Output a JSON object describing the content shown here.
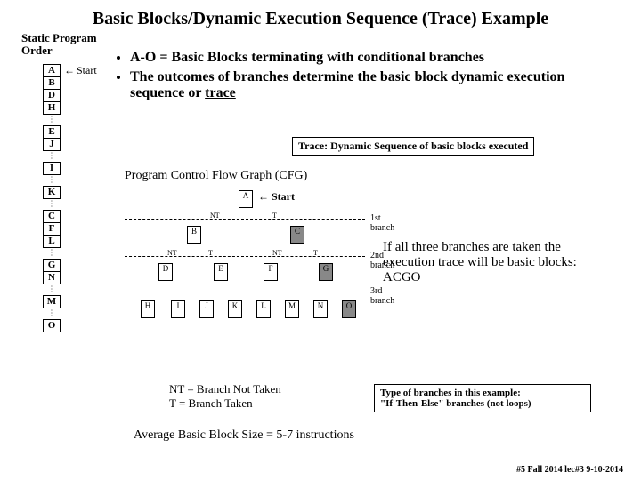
{
  "title": "Basic Blocks/Dynamic Execution Sequence (Trace) Example",
  "static_label_l1": "Static Program",
  "static_label_l2": "Order",
  "start_label": "Start",
  "blocks": [
    "A",
    "B",
    "D",
    "H",
    "",
    "E",
    "J",
    "",
    "I",
    "",
    "K",
    "",
    "C",
    "F",
    "L",
    "",
    "G",
    "N",
    "",
    "M",
    "",
    "O"
  ],
  "bullets": [
    "A-O = Basic Blocks terminating with conditional branches",
    "The outcomes of branches determine the basic block dynamic execution sequence or "
  ],
  "bullet2_underlined": "trace",
  "trace_box": "Trace:  Dynamic Sequence of basic blocks executed",
  "cfg_title": "Program Control Flow Graph (CFG)",
  "cfg_start": "Start",
  "cfg": {
    "root": "A",
    "level2": {
      "left": "B",
      "right": "C"
    },
    "level3": [
      "D",
      "E",
      "F",
      "G"
    ],
    "level4": [
      "H",
      "I",
      "J",
      "K",
      "L",
      "M",
      "N",
      "O"
    ],
    "edge_nt": "NT",
    "edge_t": "T",
    "branch_labels": [
      "1st branch",
      "2nd branch",
      "3rd branch"
    ]
  },
  "note_right": "If all three branches are taken the execution trace will be basic blocks:  ACGO",
  "legend_nt": "NT =  Branch Not Taken",
  "legend_t": "T   =  Branch Taken",
  "type_box_l1": "Type of branches in this example:",
  "type_box_l2": "\"If-Then-Else\" branches (not loops)",
  "avg": "Average Basic Block Size = 5-7 instructions",
  "footer": "#5 Fall 2014 lec#3   9-10-2014"
}
